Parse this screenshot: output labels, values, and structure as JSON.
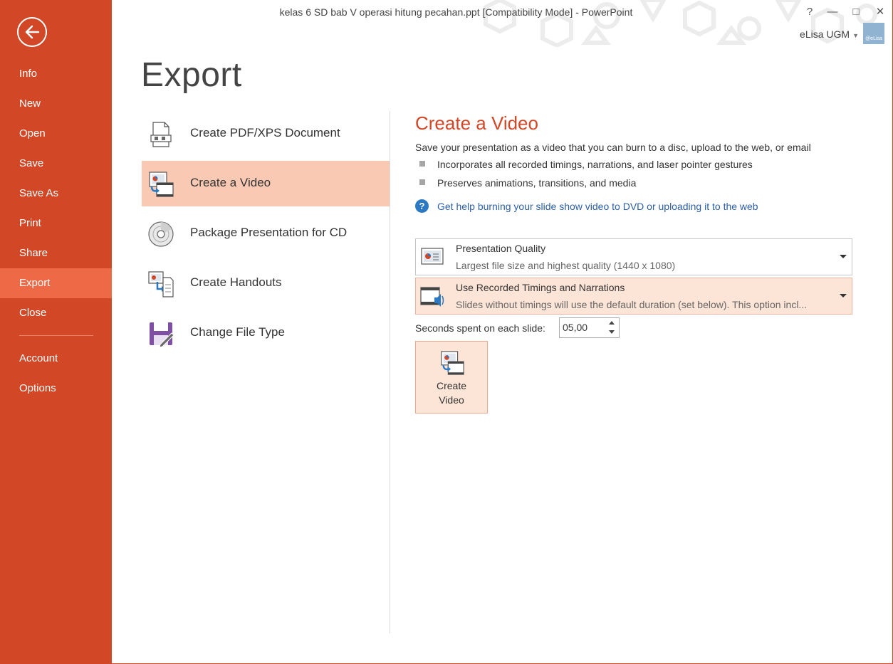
{
  "window": {
    "title": "kelas 6 SD bab V operasi hitung pecahan.ppt [Compatibility Mode] - PowerPoint",
    "help": "?",
    "minimize": "—",
    "maximize": "□",
    "close": "✕",
    "account_name": "eLisa UGM",
    "avatar_text": "@eLisa"
  },
  "sidebar": {
    "back_icon": "back-arrow-icon",
    "items": [
      {
        "label": "Info"
      },
      {
        "label": "New"
      },
      {
        "label": "Open"
      },
      {
        "label": "Save"
      },
      {
        "label": "Save As"
      },
      {
        "label": "Print"
      },
      {
        "label": "Share"
      },
      {
        "label": "Export",
        "active": true
      },
      {
        "label": "Close"
      },
      {
        "label": "Account"
      },
      {
        "label": "Options"
      }
    ]
  },
  "page": {
    "title": "Export"
  },
  "export_options": [
    {
      "label": "Create PDF/XPS Document",
      "icon": "pdf-document-icon"
    },
    {
      "label": "Create a Video",
      "icon": "video-icon",
      "active": true
    },
    {
      "label": "Package Presentation for CD",
      "icon": "cd-icon"
    },
    {
      "label": "Create Handouts",
      "icon": "handouts-icon"
    },
    {
      "label": "Change File Type",
      "icon": "file-type-icon"
    }
  ],
  "detail": {
    "title": "Create a Video",
    "description": "Save your presentation as a video that you can burn to a disc, upload to the web, or email",
    "bullets": [
      "Incorporates all recorded timings, narrations, and laser pointer gestures",
      "Preserves animations, transitions, and media"
    ],
    "help_link": "Get help burning your slide show video to DVD or uploading it to the web",
    "quality_dropdown": {
      "main": "Presentation Quality",
      "sub": "Largest file size and highest quality (1440 x 1080)"
    },
    "timings_dropdown": {
      "main": "Use Recorded Timings and Narrations",
      "sub": "Slides without timings will use the default duration (set below). This option incl..."
    },
    "seconds_label": "Seconds spent on each slide:",
    "seconds_value": "05,00",
    "create_button": {
      "line1": "Create",
      "line2": "Video"
    }
  },
  "colors": {
    "accent": "#d24726",
    "active_nav": "#ee6946",
    "selected_option": "#f9c9b4",
    "link": "#2b5fa8"
  }
}
